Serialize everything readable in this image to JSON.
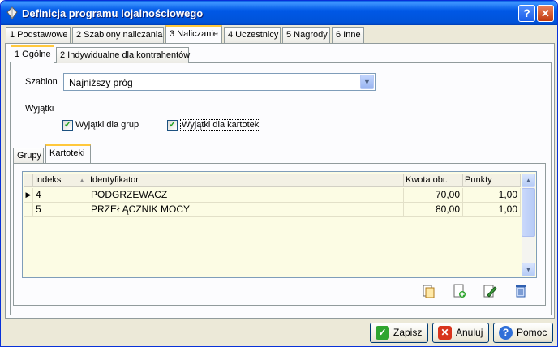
{
  "window": {
    "title": "Definicja programu lojalnościowego"
  },
  "tabs_main": [
    {
      "label": "1 Podstawowe"
    },
    {
      "label": "2 Szablony naliczania"
    },
    {
      "label": "3 Naliczanie"
    },
    {
      "label": "4 Uczestnicy"
    },
    {
      "label": "5 Nagrody"
    },
    {
      "label": "6 Inne"
    }
  ],
  "tabs_sub": [
    {
      "label": "1 Ogólne"
    },
    {
      "label": "2 Indywidualne dla kontrahentów"
    }
  ],
  "szablon": {
    "label": "Szablon",
    "value": "Najniższy próg"
  },
  "wyjatki": {
    "label": "Wyjątki",
    "grupy_label": "Wyjątki dla grup",
    "kartoteki_label": "Wyjątki dla kartotek"
  },
  "tabs_inner": [
    {
      "label": "Grupy"
    },
    {
      "label": "Kartoteki"
    }
  ],
  "grid": {
    "columns": [
      "Indeks",
      "Identyfikator",
      "Kwota obr.",
      "Punkty"
    ],
    "rows": [
      {
        "indeks": "4",
        "identyfikator": "PODGRZEWACZ",
        "kwota": "70,00",
        "punkty": "1,00"
      },
      {
        "indeks": "5",
        "identyfikator": "PRZEŁĄCZNIK MOCY",
        "kwota": "80,00",
        "punkty": "1,00"
      }
    ]
  },
  "buttons": {
    "zapisz": "Zapisz",
    "anuluj": "Anuluj",
    "pomoc": "Pomoc"
  },
  "colors": {
    "accent": "#0058e6",
    "tab_highlight": "#ffc83c",
    "grid_bg": "#fcfce4"
  }
}
